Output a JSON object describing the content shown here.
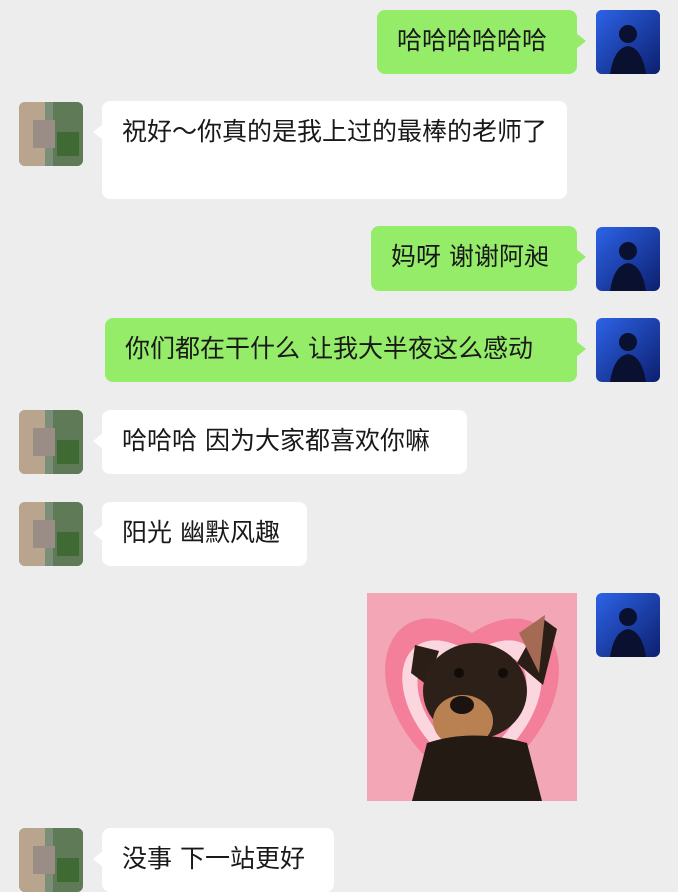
{
  "messages": [
    {
      "sender": "self",
      "type": "text",
      "text": "哈哈哈哈哈哈"
    },
    {
      "sender": "other",
      "type": "text",
      "text": "祝好～你真的是我上过的最棒的老师了"
    },
    {
      "sender": "self",
      "type": "text",
      "text": "妈呀 谢谢阿昶"
    },
    {
      "sender": "self",
      "type": "text",
      "text": "你们都在干什么 让我大半夜这么感动"
    },
    {
      "sender": "other",
      "type": "text",
      "text": "哈哈哈 因为大家都喜欢你嘛"
    },
    {
      "sender": "other",
      "type": "text",
      "text": "阳光 幽默风趣"
    },
    {
      "sender": "self",
      "type": "sticker",
      "description_icon": "dog-heart-sticker"
    },
    {
      "sender": "other",
      "type": "text",
      "text": "没事 下一站更好"
    }
  ],
  "colors": {
    "background": "#ededed",
    "outgoing_bubble": "#95ec69",
    "incoming_bubble": "#ffffff",
    "text": "#191919"
  }
}
